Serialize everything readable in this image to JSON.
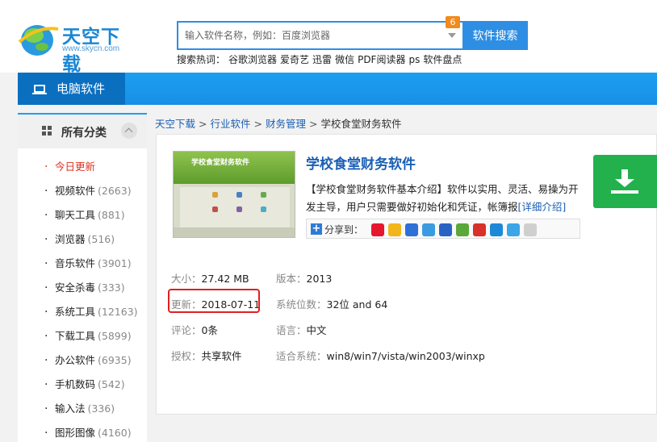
{
  "header": {
    "logo_text": "天空下载",
    "logo_url": "www.skycn.com",
    "search_placeholder": "输入软件名称，例如：百度浏览器",
    "search_badge": "6",
    "search_button": "软件搜索",
    "hot_label": "搜索热词：",
    "hot_words": [
      "谷歌浏览器",
      "爱奇艺",
      "迅雷",
      "微信",
      "PDF阅读器",
      "ps",
      "软件盘点"
    ]
  },
  "nav": {
    "active_label": "电脑软件"
  },
  "sidebar": {
    "title": "所有分类",
    "items": [
      {
        "label": "今日更新",
        "count": ""
      },
      {
        "label": "视频软件",
        "count": "(2663)"
      },
      {
        "label": "聊天工具",
        "count": "(881)"
      },
      {
        "label": "浏览器",
        "count": "(516)"
      },
      {
        "label": "音乐软件",
        "count": "(3901)"
      },
      {
        "label": "安全杀毒",
        "count": "(333)"
      },
      {
        "label": "系统工具",
        "count": "(12163)"
      },
      {
        "label": "下载工具",
        "count": "(5899)"
      },
      {
        "label": "办公软件",
        "count": "(6935)"
      },
      {
        "label": "手机数码",
        "count": "(542)"
      },
      {
        "label": "输入法",
        "count": "(336)"
      },
      {
        "label": "图形图像",
        "count": "(4160)"
      }
    ]
  },
  "breadcrumb": {
    "items": [
      "天空下载",
      "行业软件",
      "财务管理"
    ],
    "current": "学校食堂财务软件",
    "sep": ">"
  },
  "app": {
    "thumb_title": "学校食堂财务软件",
    "title": "学校食堂财务软件",
    "description": "【学校食堂财务软件基本介绍】软件以实用、灵活、易操为开发主导，用户只需要做好初始化和凭证，帐簿报",
    "more_link": "[详细介绍]",
    "share_label": "分享到：",
    "share_plus": "+"
  },
  "details": {
    "size_k": "大小：",
    "size_v": "27.42 MB",
    "version_k": "版本：",
    "version_v": "2013",
    "update_k": "更新：",
    "update_v": "2018-07-11",
    "bits_k": "系统位数：",
    "bits_v": "32位 and 64",
    "comment_k": "评论：",
    "comment_v": "0条",
    "lang_k": "语言：",
    "lang_v": "中文",
    "license_k": "授权：",
    "license_v": "共享软件",
    "os_k": "适合系统：",
    "os_v": "win8/win7/vista/win2003/winxp"
  },
  "colors": {
    "brand_blue": "#1d9ef0",
    "download_green": "#22b14c",
    "highlight_red": "#e02020"
  }
}
